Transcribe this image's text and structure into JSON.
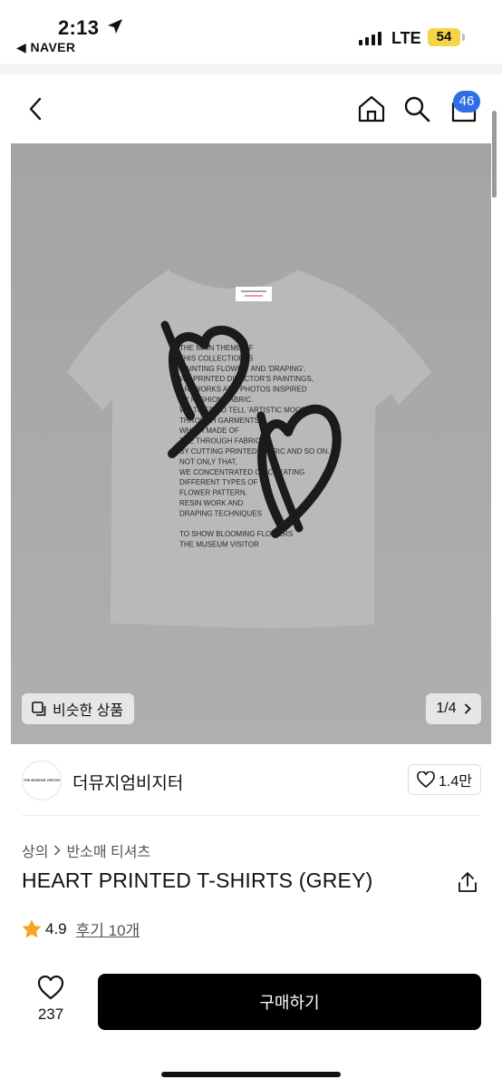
{
  "status_bar": {
    "time": "2:13",
    "back_app": "◀ NAVER",
    "network": "LTE",
    "battery": "54"
  },
  "header": {
    "cart_count": "46",
    "icons": [
      "back-icon",
      "home-icon",
      "search-icon",
      "cart-icon"
    ]
  },
  "product_image": {
    "similar_label": "비슷한 상품",
    "pager": "1/4",
    "shirt_text": [
      "THE MAIN THEME OF",
      "THIS COLLECTION IS",
      "'PAINTING FLOWER' AND 'DRAPING'.",
      "WE PRINTED DIRECTOR'S PAINTINGS,",
      "ARTWORKS AND PHOTOS INSPIRED",
      "BY FASHION FABRIC.",
      "WE TRIED TO TELL 'ARTISTIC MOOD'",
      "THROUGH GARMENTS",
      "WHICH MADE OF",
      "THE THROUGH FABRIC.",
      "BY CUTTING PRINTED FABRIC AND SO ON.",
      "NOT ONLY THAT,",
      "WE CONCENTRATED ON CREATING",
      "DIFFERENT TYPES OF",
      "FLOWER PATTERN,",
      "RESIN WORK AND",
      "DRAPING TECHNIQUES",
      "",
      "TO SHOW BLOOMING FLOWERS",
      "THE MUSEUM VISITOR"
    ],
    "label_text": "THE MUSEUM VISITOR"
  },
  "brand": {
    "logo_text": "THE MUSEUM VISITOR",
    "name": "더뮤지엄비지터",
    "likes": "1.4만"
  },
  "breadcrumb": {
    "category": "상의",
    "subcategory": "반소매 티셔츠"
  },
  "product": {
    "title": "HEART PRINTED T-SHIRTS (GREY)",
    "rating": "4.9",
    "reviews": "후기 10개"
  },
  "bottom_bar": {
    "wish_count": "237",
    "buy_label": "구매하기"
  },
  "colors": {
    "accent_badge": "#2f6ee5",
    "battery": "#f5d547",
    "star": "#f5a623",
    "buy_button": "#000000"
  }
}
